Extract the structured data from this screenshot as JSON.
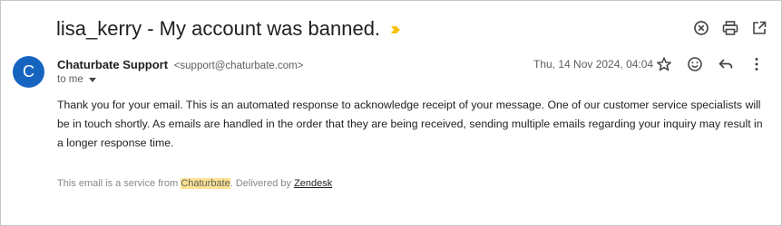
{
  "email": {
    "subject": "lisa_kerry - My account was banned.",
    "importance_marker_color": "#f4c20d",
    "sender": {
      "avatar_letter": "C",
      "avatar_color": "#1565c0",
      "name": "Chaturbate Support",
      "address": "<support@chaturbate.com>"
    },
    "recipient_label": "to me",
    "date": "Thu, 14 Nov 2024, 04:04",
    "body": "Thank you for your email. This is an automated response to acknowledge receipt of your message. One of our customer service specialists will be in touch shortly. As emails are handled in the order that they are being received, sending multiple emails regarding your inquiry may result in a longer response time.",
    "footer": {
      "prefix": "This email is a service from ",
      "brand": "Chaturbate",
      "middle": ". Delivered by ",
      "link": "Zendesk"
    }
  },
  "toolbar": {
    "icons": [
      "close-circle-icon",
      "print-icon",
      "open-in-new-window-icon"
    ]
  },
  "message_actions": {
    "icons": [
      "star-icon",
      "emoji-icon",
      "reply-icon",
      "more-vert-icon"
    ]
  }
}
